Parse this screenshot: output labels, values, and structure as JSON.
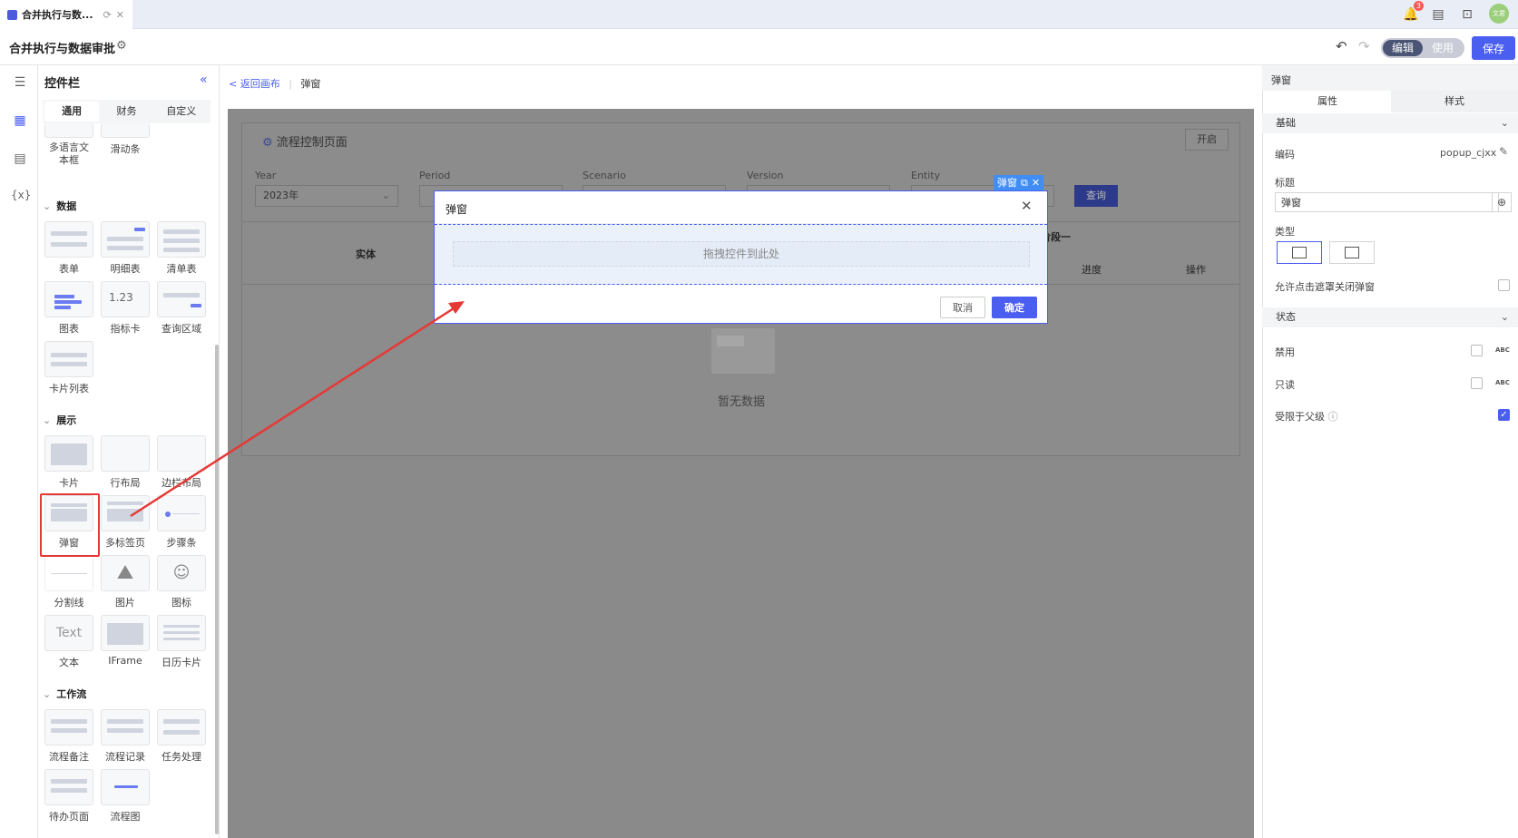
{
  "tab": {
    "title": "合并执行与数..."
  },
  "header": {
    "title": "合并执行与数据审批",
    "mode_edit": "编辑",
    "mode_use": "使用",
    "save": "保存",
    "avatar": "文君",
    "notif_count": "3"
  },
  "panel": {
    "title": "控件栏",
    "tabs": [
      "通用",
      "财务",
      "自定义"
    ],
    "top_items": [
      "多语言文本框",
      "滑动条"
    ],
    "sections": {
      "data": {
        "title": "数据",
        "items": [
          "表单",
          "明细表",
          "清单表",
          "图表",
          "指标卡",
          "查询区域",
          "卡片列表"
        ]
      },
      "display": {
        "title": "展示",
        "items": [
          "卡片",
          "行布局",
          "边栏布局",
          "弹窗",
          "多标签页",
          "步骤条",
          "分割线",
          "图片",
          "图标",
          "文本",
          "IFrame",
          "日历卡片"
        ]
      },
      "workflow": {
        "title": "工作流",
        "items": [
          "流程备注",
          "流程记录",
          "任务处理",
          "待办页面",
          "流程图"
        ]
      }
    },
    "indicator_sample": "1.23",
    "text_sample": "Text"
  },
  "breadcrumb": {
    "back": "< 返回画布",
    "current": "弹窗"
  },
  "canvas": {
    "page_title": "流程控制页面",
    "open_btn": "开启",
    "filters": [
      {
        "label": "Year",
        "value": "2023年"
      },
      {
        "label": "Period",
        "value": ""
      },
      {
        "label": "Scenario",
        "value": ""
      },
      {
        "label": "Version",
        "value": ""
      },
      {
        "label": "Entity",
        "value": ""
      }
    ],
    "query_btn": "查询",
    "table": {
      "col_entity": "实体",
      "col_stage": "阶段一",
      "col_progress": "进度",
      "col_action": "操作"
    },
    "empty": "暂无数据"
  },
  "modal": {
    "tag": "弹窗",
    "title": "弹窗",
    "drop_hint": "拖拽控件到此处",
    "cancel": "取消",
    "ok": "确定"
  },
  "right": {
    "header": "弹窗",
    "tabs": [
      "属性",
      "样式"
    ],
    "basic": "基础",
    "code_label": "编码",
    "code_value": "popup_cjxx",
    "title_label": "标题",
    "title_value": "弹窗",
    "type_label": "类型",
    "mask_close_label": "允许点击遮罩关闭弹窗",
    "status": "状态",
    "disabled_label": "禁用",
    "readonly_label": "只读",
    "limit_parent_label": "受限于父级",
    "abc": "ABC",
    "limit_parent_checked": true
  },
  "colors": {
    "accent": "#4a5ef0",
    "highlight": "#e53935",
    "tag": "#3f8df5"
  }
}
